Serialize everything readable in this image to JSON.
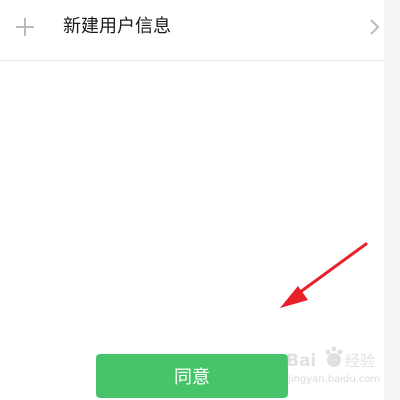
{
  "list_row": {
    "label": "新建用户信息",
    "left_icon": "plus-icon",
    "right_icon": "chevron-right-icon"
  },
  "dialog": {
    "agree_label": "同意"
  },
  "annotation": {
    "type": "red-arrow",
    "color": "#e8202a"
  },
  "watermark": {
    "brand": "Baidu 经验",
    "url": "jingyan.baidu.com"
  },
  "colors": {
    "button_green": "#47c46a",
    "text": "#1a1a1a",
    "divider": "#ececec",
    "icon_gray": "#bbbbbb"
  }
}
